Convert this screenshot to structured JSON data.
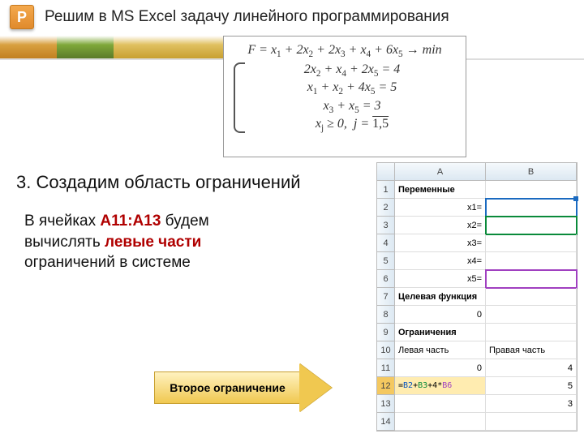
{
  "logo_letter": "P",
  "title": "Решим в MS Excel задачу линейного программирования",
  "math": {
    "objective": "F = x₁ + 2x₂ + 2x₃ + x₄ + 6x₅ → min",
    "c1": "2x₂ + x₄ + 2x₅ = 4",
    "c2": "x₁ + x₂ + 4x₅ = 5",
    "c3": "x₃ + x₅ = 3",
    "c4_pre": "xⱼ ≥ 0,  j = ",
    "c4_range": "1,5"
  },
  "section": "3. Создадим область ограничений",
  "body": {
    "l1a": "В ячейках ",
    "l1b": "А11:А13",
    "l1c": " будем",
    "l2a": "вычислять ",
    "l2b": "левые части",
    "l3": "ограничений в системе"
  },
  "arrow_label": "Второе ограничение",
  "excel": {
    "cols": [
      "A",
      "B"
    ],
    "rows": [
      {
        "n": "1",
        "a": "Переменные",
        "b": "",
        "abold": true
      },
      {
        "n": "2",
        "a": "x1=",
        "b": ""
      },
      {
        "n": "3",
        "a": "x2=",
        "b": ""
      },
      {
        "n": "4",
        "a": "x3=",
        "b": ""
      },
      {
        "n": "5",
        "a": "x4=",
        "b": ""
      },
      {
        "n": "6",
        "a": "x5=",
        "b": ""
      },
      {
        "n": "7",
        "a": "Целевая функция",
        "b": "",
        "abold": true
      },
      {
        "n": "8",
        "a": "0",
        "b": ""
      },
      {
        "n": "9",
        "a": "Ограничения",
        "b": "",
        "abold": true
      },
      {
        "n": "10",
        "a": "Левая часть",
        "b": "Правая часть"
      },
      {
        "n": "11",
        "a": "0",
        "b": "4"
      },
      {
        "n": "12",
        "a": "=B2+B3+4*B6",
        "b": "5",
        "formula": true
      },
      {
        "n": "13",
        "a": "",
        "b": "3"
      },
      {
        "n": "14",
        "a": "",
        "b": ""
      }
    ]
  }
}
